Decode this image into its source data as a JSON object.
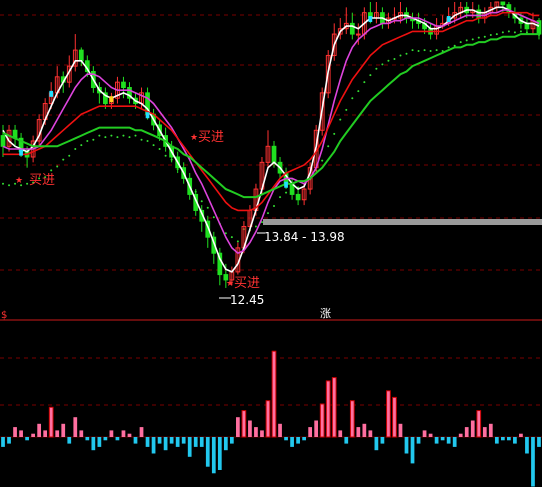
{
  "colors": {
    "background": "#000000",
    "grid": "#7a0000",
    "up": "#ff3232",
    "down": "#20e020",
    "ma_white": "#ffffff",
    "ma_magenta": "#dd44dd",
    "ma_red": "#ee1111",
    "ma_green": "#22cc22",
    "dots": "#33dd33",
    "hist_pos": "#ff6fa0",
    "hist_neg": "#22c8ee",
    "band": "#9a9a9a",
    "signal_text": "#ff3232",
    "price_text": "#ffffff",
    "marker_cyan": "#22e0ff",
    "marker_yellow": "#ffd21e"
  },
  "panels": {
    "upper_indicator_label": "$",
    "lower_indicator_label": "涨"
  },
  "annotations": {
    "signals": [
      "买进",
      "买进",
      "买进"
    ],
    "range_label": "13.84 - 13.98",
    "low_label": "12.45"
  },
  "chart_data": [
    {
      "type": "candlestick",
      "ylim": [
        12.0,
        17.8
      ],
      "grid": true,
      "x": [
        "0",
        "1",
        "2",
        "3",
        "4",
        "5",
        "6",
        "7",
        "8",
        "9",
        "10",
        "11",
        "12",
        "13",
        "14",
        "15",
        "16",
        "17",
        "18",
        "19",
        "20",
        "21",
        "22",
        "23",
        "24",
        "25",
        "26",
        "27",
        "28",
        "29",
        "30",
        "31",
        "32",
        "33",
        "34",
        "35",
        "36",
        "37",
        "38",
        "39",
        "40",
        "41",
        "42",
        "43",
        "44",
        "45",
        "46",
        "47",
        "48",
        "49",
        "50",
        "51",
        "52",
        "53",
        "54",
        "55",
        "56",
        "57",
        "58",
        "59",
        "60",
        "61",
        "62",
        "63",
        "64",
        "65",
        "66",
        "67",
        "68",
        "69",
        "70",
        "71",
        "72",
        "73",
        "74",
        "75",
        "76",
        "77",
        "78",
        "79",
        "80",
        "81",
        "82",
        "83",
        "84",
        "85",
        "86",
        "87",
        "88",
        "89"
      ],
      "candles": {
        "open": [
          15.3,
          15.1,
          15.4,
          15.25,
          15.0,
          14.9,
          15.2,
          15.6,
          15.9,
          16.1,
          16.4,
          16.3,
          16.6,
          16.9,
          16.7,
          16.5,
          16.2,
          16.1,
          15.9,
          16.0,
          16.3,
          16.2,
          16.0,
          15.9,
          16.1,
          15.7,
          15.5,
          15.3,
          15.1,
          14.9,
          14.7,
          14.5,
          14.2,
          13.9,
          13.7,
          13.4,
          13.1,
          12.7,
          12.6,
          12.75,
          13.2,
          13.6,
          13.9,
          14.3,
          14.8,
          15.1,
          14.8,
          14.6,
          14.4,
          14.2,
          14.1,
          14.3,
          14.7,
          15.4,
          16.1,
          16.8,
          17.2,
          17.3,
          17.4,
          17.2,
          17.2,
          17.6,
          17.5,
          17.6,
          17.4,
          17.5,
          17.5,
          17.6,
          17.5,
          17.45,
          17.4,
          17.3,
          17.2,
          17.35,
          17.4,
          17.5,
          17.6,
          17.7,
          17.6,
          17.65,
          17.5,
          17.6,
          17.7,
          17.8,
          17.75,
          17.6,
          17.5,
          17.4,
          17.3,
          17.45
        ],
        "close": [
          15.1,
          15.4,
          15.25,
          15.0,
          14.9,
          15.2,
          15.6,
          15.9,
          16.1,
          16.4,
          16.3,
          16.6,
          16.9,
          16.7,
          16.5,
          16.2,
          16.1,
          15.9,
          16.0,
          16.3,
          16.2,
          16.0,
          15.9,
          16.1,
          15.7,
          15.5,
          15.3,
          15.1,
          14.9,
          14.7,
          14.5,
          14.2,
          13.9,
          13.7,
          13.4,
          13.1,
          12.7,
          12.6,
          12.75,
          13.2,
          13.6,
          13.9,
          14.3,
          14.8,
          15.1,
          14.8,
          14.6,
          14.4,
          14.2,
          14.1,
          14.3,
          14.7,
          15.4,
          16.1,
          16.8,
          17.2,
          17.3,
          17.4,
          17.2,
          17.2,
          17.6,
          17.5,
          17.6,
          17.4,
          17.5,
          17.5,
          17.6,
          17.5,
          17.45,
          17.4,
          17.3,
          17.2,
          17.35,
          17.4,
          17.5,
          17.6,
          17.7,
          17.6,
          17.65,
          17.5,
          17.6,
          17.7,
          17.8,
          17.75,
          17.6,
          17.5,
          17.4,
          17.3,
          17.45,
          17.2
        ],
        "high": [
          15.5,
          15.5,
          15.5,
          15.35,
          15.1,
          15.3,
          15.7,
          16.0,
          16.3,
          16.6,
          16.5,
          16.8,
          17.2,
          16.95,
          16.8,
          16.6,
          16.3,
          16.2,
          16.1,
          16.4,
          16.4,
          16.3,
          16.1,
          16.2,
          16.2,
          15.8,
          15.6,
          15.45,
          15.2,
          15.0,
          14.8,
          14.6,
          14.3,
          14.0,
          13.8,
          13.5,
          13.2,
          12.9,
          12.85,
          13.3,
          13.7,
          14.0,
          14.4,
          14.9,
          15.4,
          15.2,
          14.9,
          14.7,
          14.5,
          14.3,
          14.4,
          14.8,
          15.5,
          16.2,
          16.9,
          17.4,
          17.5,
          17.7,
          17.6,
          17.4,
          17.7,
          17.8,
          17.8,
          17.7,
          17.6,
          17.7,
          17.8,
          17.7,
          17.6,
          17.6,
          17.5,
          17.4,
          17.5,
          17.55,
          17.7,
          17.8,
          17.8,
          17.8,
          17.8,
          17.75,
          17.7,
          17.8,
          17.8,
          17.8,
          17.8,
          17.7,
          17.6,
          17.5,
          17.6,
          17.5
        ],
        "low": [
          14.9,
          15.0,
          15.1,
          14.9,
          14.7,
          14.8,
          15.1,
          15.5,
          15.8,
          16.0,
          16.1,
          16.2,
          16.5,
          16.6,
          16.4,
          16.1,
          15.9,
          15.8,
          15.8,
          15.9,
          16.0,
          15.9,
          15.8,
          15.8,
          15.6,
          15.4,
          15.2,
          15.0,
          14.8,
          14.6,
          14.4,
          14.1,
          13.8,
          13.5,
          13.2,
          12.9,
          12.5,
          12.45,
          12.5,
          12.7,
          13.1,
          13.5,
          13.8,
          14.2,
          14.7,
          14.7,
          14.5,
          14.3,
          14.1,
          14.0,
          14.0,
          14.2,
          14.6,
          15.3,
          16.0,
          16.7,
          17.1,
          17.2,
          17.1,
          17.0,
          17.1,
          17.4,
          17.4,
          17.3,
          17.3,
          17.4,
          17.4,
          17.4,
          17.3,
          17.3,
          17.2,
          17.1,
          17.1,
          17.3,
          17.35,
          17.4,
          17.5,
          17.5,
          17.5,
          17.4,
          17.4,
          17.55,
          17.6,
          17.6,
          17.5,
          17.4,
          17.3,
          17.2,
          17.2,
          17.1
        ]
      },
      "series": [
        {
          "values": [
            15.4,
            15.2,
            15.1,
            15.05,
            15.0,
            15.1,
            15.3,
            15.6,
            15.85,
            16.1,
            16.3,
            16.5,
            16.7,
            16.7,
            16.55,
            16.35,
            16.15,
            16.05,
            16.0,
            16.05,
            16.1,
            16.05,
            15.95,
            15.9,
            15.8,
            15.6,
            15.4,
            15.2,
            15.0,
            14.8,
            14.6,
            14.35,
            14.1,
            13.85,
            13.6,
            13.3,
            13.0,
            12.8,
            12.75,
            12.9,
            13.2,
            13.55,
            13.9,
            14.3,
            14.7,
            14.8,
            14.7,
            14.55,
            14.4,
            14.3,
            14.35,
            14.6,
            15.1,
            15.8,
            16.5,
            17.0,
            17.25,
            17.35,
            17.35,
            17.3,
            17.4,
            17.5,
            17.5,
            17.5,
            17.45,
            17.5,
            17.55,
            17.55,
            17.5,
            17.45,
            17.4,
            17.3,
            17.3,
            17.35,
            17.45,
            17.55,
            17.6,
            17.65,
            17.65,
            17.6,
            17.6,
            17.65,
            17.7,
            17.7,
            17.65,
            17.55,
            17.45,
            17.4,
            17.4,
            17.35
          ]
        },
        {
          "values": [
            15.1,
            15.05,
            15.05,
            15.05,
            15.05,
            15.05,
            15.1,
            15.25,
            15.4,
            15.6,
            15.8,
            16.0,
            16.2,
            16.35,
            16.45,
            16.45,
            16.4,
            16.3,
            16.2,
            16.15,
            16.15,
            16.15,
            16.1,
            16.05,
            16.0,
            15.9,
            15.75,
            15.6,
            15.45,
            15.25,
            15.05,
            14.85,
            14.6,
            14.4,
            14.15,
            13.9,
            13.65,
            13.4,
            13.2,
            13.1,
            13.15,
            13.3,
            13.5,
            13.75,
            14.05,
            14.3,
            14.45,
            14.5,
            14.5,
            14.45,
            14.4,
            14.5,
            14.7,
            15.05,
            15.5,
            15.95,
            16.35,
            16.7,
            16.95,
            17.1,
            17.2,
            17.3,
            17.35,
            17.4,
            17.4,
            17.45,
            17.45,
            17.5,
            17.5,
            17.5,
            17.45,
            17.4,
            17.35,
            17.35,
            17.4,
            17.45,
            17.5,
            17.55,
            17.55,
            17.55,
            17.55,
            17.6,
            17.6,
            17.65,
            17.65,
            17.6,
            17.55,
            17.5,
            17.45,
            17.4
          ]
        },
        {
          "values": [
            14.95,
            14.95,
            14.95,
            14.95,
            14.95,
            15.0,
            15.05,
            15.1,
            15.2,
            15.3,
            15.4,
            15.5,
            15.6,
            15.7,
            15.75,
            15.8,
            15.85,
            15.85,
            15.85,
            15.85,
            15.85,
            15.85,
            15.85,
            15.8,
            15.75,
            15.7,
            15.6,
            15.5,
            15.4,
            15.25,
            15.1,
            14.95,
            14.8,
            14.65,
            14.5,
            14.35,
            14.2,
            14.05,
            13.95,
            13.9,
            13.9,
            13.9,
            13.95,
            14.05,
            14.2,
            14.35,
            14.5,
            14.6,
            14.65,
            14.7,
            14.75,
            14.85,
            15.0,
            15.2,
            15.45,
            15.7,
            15.95,
            16.15,
            16.35,
            16.5,
            16.65,
            16.8,
            16.9,
            17.0,
            17.05,
            17.1,
            17.15,
            17.2,
            17.25,
            17.25,
            17.25,
            17.25,
            17.25,
            17.25,
            17.3,
            17.35,
            17.4,
            17.45,
            17.45,
            17.5,
            17.5,
            17.55,
            17.55,
            17.6,
            17.6,
            17.6,
            17.6,
            17.6,
            17.55,
            17.55
          ]
        },
        {
          "values": [
            15.35,
            15.3,
            15.25,
            15.2,
            15.15,
            15.1,
            15.1,
            15.1,
            15.1,
            15.1,
            15.15,
            15.2,
            15.25,
            15.3,
            15.35,
            15.4,
            15.45,
            15.45,
            15.45,
            15.45,
            15.45,
            15.45,
            15.4,
            15.4,
            15.35,
            15.3,
            15.25,
            15.2,
            15.1,
            15.05,
            14.95,
            14.9,
            14.8,
            14.7,
            14.6,
            14.5,
            14.4,
            14.3,
            14.25,
            14.2,
            14.15,
            14.15,
            14.15,
            14.2,
            14.25,
            14.3,
            14.35,
            14.4,
            14.4,
            14.45,
            14.45,
            14.5,
            14.6,
            14.7,
            14.85,
            15.0,
            15.2,
            15.35,
            15.5,
            15.65,
            15.8,
            15.95,
            16.05,
            16.15,
            16.25,
            16.35,
            16.45,
            16.5,
            16.6,
            16.65,
            16.7,
            16.75,
            16.8,
            16.85,
            16.9,
            16.95,
            16.95,
            17.0,
            17.0,
            17.05,
            17.05,
            17.1,
            17.1,
            17.15,
            17.15,
            17.15,
            17.2,
            17.2,
            17.2,
            17.2
          ]
        }
      ]
    },
    {
      "type": "bar",
      "x": [
        "0",
        "1",
        "2",
        "3",
        "4",
        "5",
        "6",
        "7",
        "8",
        "9",
        "10",
        "11",
        "12",
        "13",
        "14",
        "15",
        "16",
        "17",
        "18",
        "19",
        "20",
        "21",
        "22",
        "23",
        "24",
        "25",
        "26",
        "27",
        "28",
        "29",
        "30",
        "31",
        "32",
        "33",
        "34",
        "35",
        "36",
        "37",
        "38",
        "39",
        "40",
        "41",
        "42",
        "43",
        "44",
        "45",
        "46",
        "47",
        "48",
        "49",
        "50",
        "51",
        "52",
        "53",
        "54",
        "55",
        "56",
        "57",
        "58",
        "59",
        "60",
        "61",
        "62",
        "63",
        "64",
        "65",
        "66",
        "67",
        "68",
        "69",
        "70",
        "71",
        "72",
        "73",
        "74",
        "75",
        "76",
        "77",
        "78",
        "79",
        "80",
        "81",
        "82",
        "83",
        "84",
        "85",
        "86",
        "87",
        "88",
        "89"
      ],
      "values": [
        -3,
        -2,
        3,
        2,
        -1,
        1,
        4,
        2,
        9,
        2,
        4,
        -2,
        6,
        2,
        -1,
        -4,
        -3,
        -1,
        2,
        -1,
        2,
        1,
        -2,
        3,
        -3,
        -5,
        -2,
        -4,
        -2,
        -3,
        -2,
        -6,
        -3,
        -3,
        -9,
        -11,
        -10,
        -4,
        -2,
        6,
        8,
        5,
        3,
        2,
        11,
        26,
        4,
        -1,
        -3,
        -2,
        -1,
        3,
        5,
        10,
        17,
        18,
        2,
        -2,
        11,
        3,
        4,
        2,
        -4,
        -2,
        14,
        12,
        4,
        -5,
        -8,
        -2,
        2,
        1,
        -2,
        -1,
        -2,
        -3,
        1,
        3,
        5,
        8,
        3,
        4,
        -2,
        -1,
        -1,
        -2,
        1,
        -5,
        -15,
        -3
      ],
      "ylim": [
        -14,
        30
      ]
    }
  ]
}
